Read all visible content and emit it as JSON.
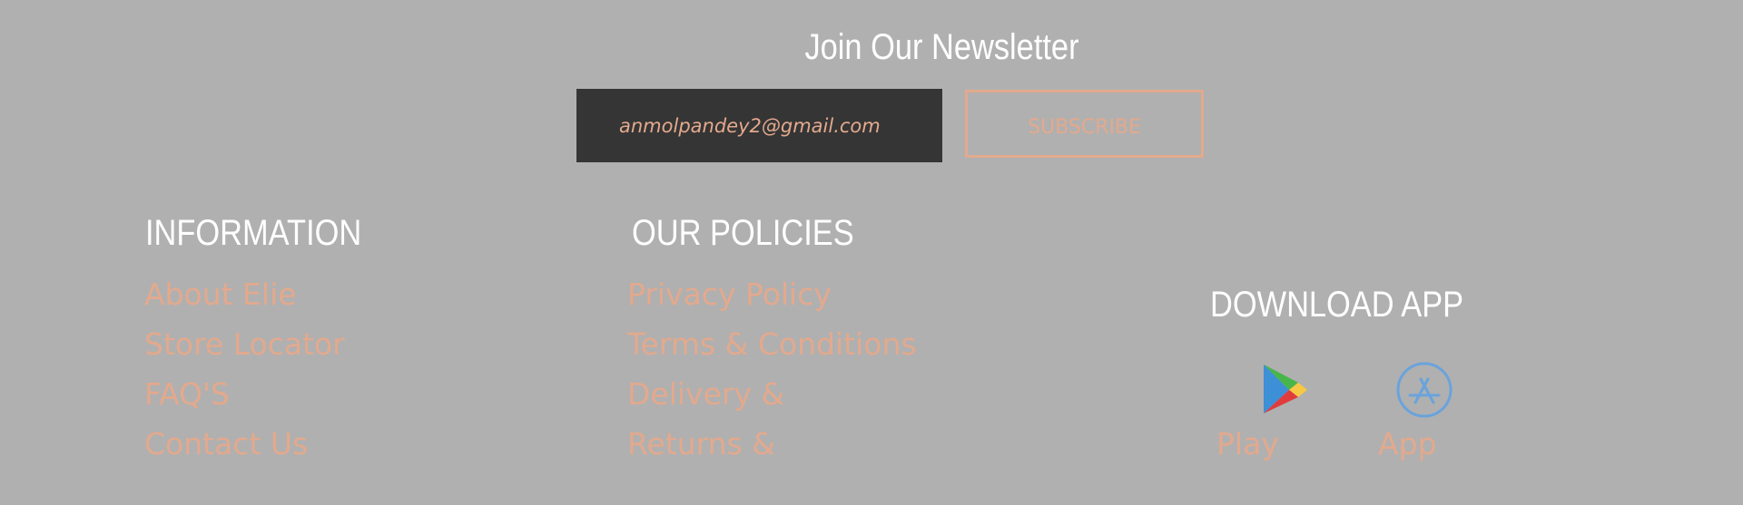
{
  "newsletter": {
    "title": "Join Our Newsletter",
    "email_value": "anmolpandey2@gmail.com",
    "subscribe_label": "SUBSCRIBE"
  },
  "information": {
    "heading": "INFORMATION",
    "links": [
      "About Elie",
      "Store Locator",
      "FAQ'S",
      "Contact Us"
    ]
  },
  "policies": {
    "heading": "OUR POLICIES",
    "links": [
      "Privacy Policy",
      "Terms & Conditions",
      "Delivery &",
      "Returns &"
    ]
  },
  "download": {
    "heading": "DOWNLOAD APP",
    "apps": [
      {
        "label": "Play",
        "icon": "google-play-icon"
      },
      {
        "label": "App",
        "icon": "app-store-icon"
      }
    ]
  },
  "colors": {
    "background": "#b0b0b0",
    "accent": "#e3a98d",
    "input_bg": "#353535",
    "heading": "#ffffff",
    "app_store_blue": "#5a9bd8"
  }
}
